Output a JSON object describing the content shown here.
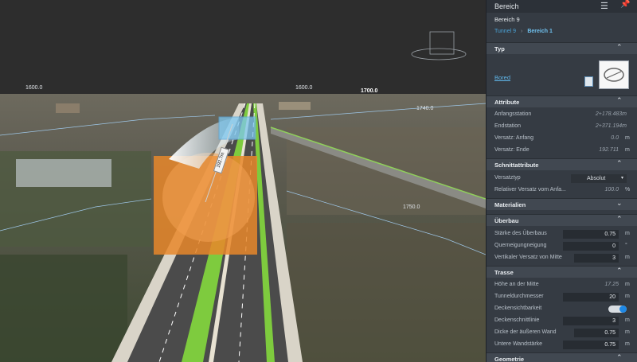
{
  "viewport": {
    "elevations": [
      "1600.0",
      "1600.0",
      "1700.0",
      "1740.0",
      "1750.0"
    ],
    "tunnel_label": "192.7m"
  },
  "panel": {
    "title": "Bereich",
    "subtitle": "Bereich 9",
    "breadcrumb": {
      "parent": "Tunnel 9",
      "current": "Bereich 1"
    },
    "sections": {
      "typ": {
        "label": "Typ",
        "link": "Bored"
      },
      "attribute": {
        "label": "Attribute",
        "rows": [
          {
            "key": "Anfangsstation",
            "value": "2+178.483m",
            "unit": ""
          },
          {
            "key": "Endstation",
            "value": "2+371.194m",
            "unit": ""
          },
          {
            "key": "Versatz: Anfang",
            "value": "0.0",
            "unit": "m"
          },
          {
            "key": "Versatz: Ende",
            "value": "192.711",
            "unit": "m"
          }
        ]
      },
      "schnitt": {
        "label": "Schnittattribute",
        "versatztyp_key": "Versatztyp",
        "versatztyp_value": "Absolut",
        "rel_key": "Relativer Versatz vom Anfa...",
        "rel_value": "100.0",
        "rel_unit": "%"
      },
      "materialien": {
        "label": "Materialien"
      },
      "ueberbau": {
        "label": "Überbau",
        "rows": [
          {
            "key": "Stärke des Überbaus",
            "value": "0.75",
            "unit": "m"
          },
          {
            "key": "Querneigungneigung",
            "value": "0",
            "unit": "°"
          },
          {
            "key": "Vertikaler Versatz von Mitte",
            "value": "3",
            "unit": "m"
          }
        ]
      },
      "trasse": {
        "label": "Trasse",
        "hoehe_key": "Höhe an der Mitte",
        "hoehe_value": "17.25",
        "hoehe_unit": "m",
        "rows": [
          {
            "key": "Tunneldurchmesser",
            "value": "20",
            "unit": "m"
          }
        ],
        "decke_key": "Deckensichtbarkeit",
        "rows2": [
          {
            "key": "Deckenschnittlinie",
            "value": "3",
            "unit": "m"
          },
          {
            "key": "Dicke der äußeren Wand",
            "value": "0.75",
            "unit": "m"
          },
          {
            "key": "Untere Wandstärke",
            "value": "0.75",
            "unit": "m"
          }
        ]
      },
      "geometrie": {
        "label": "Geometrie"
      }
    }
  }
}
